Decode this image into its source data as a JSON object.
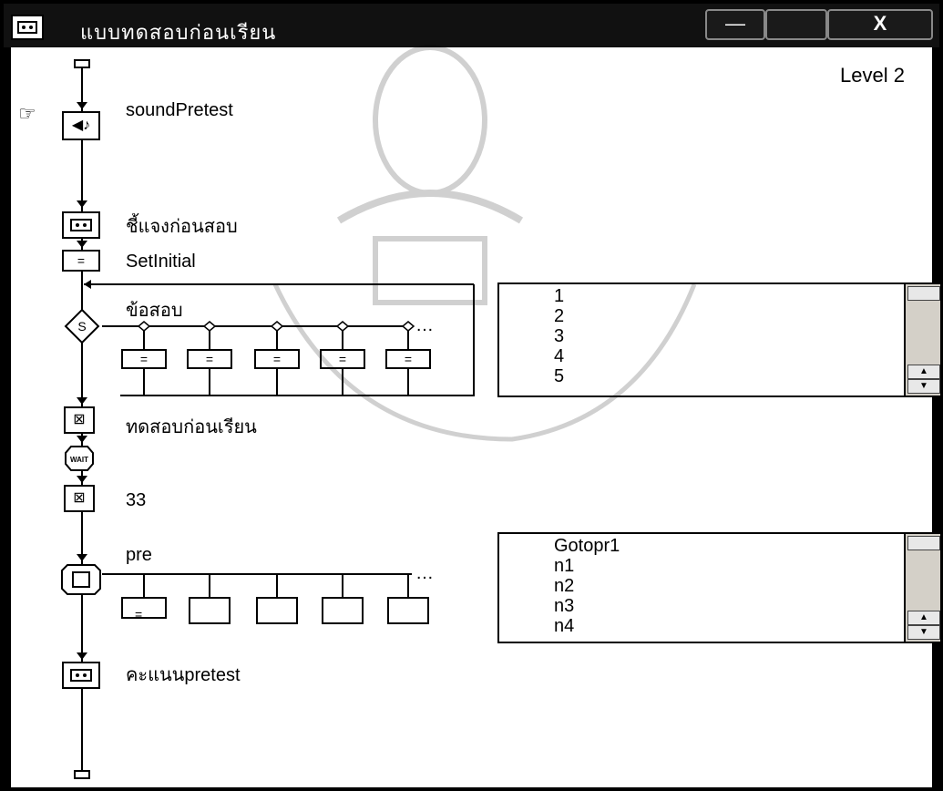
{
  "window": {
    "title": "แบบทดสอบก่อนเรียน",
    "level_label": "Level 2"
  },
  "titlebar": {
    "minimize_glyph": "—",
    "maximize_glyph": "",
    "close_glyph": "X"
  },
  "flow": {
    "nodes": [
      {
        "label": "soundPretest",
        "icon": "sound-icon"
      },
      {
        "label": "ชี้แจงก่อนสอบ",
        "icon": "map-icon"
      },
      {
        "label": "SetInitial",
        "icon": "calculation-icon"
      },
      {
        "label": "ข้อสอบ",
        "icon": "decision-icon",
        "decision_letter": "S"
      },
      {
        "label": "ทดสอบก่อนเรียน",
        "icon": "erase-icon"
      },
      {
        "label": "WAIT",
        "icon": "wait-icon"
      },
      {
        "label": "33",
        "icon": "erase-icon"
      },
      {
        "label": "pre",
        "icon": "framework-icon"
      },
      {
        "label": "คะแนนpretest",
        "icon": "map-icon"
      }
    ],
    "decision_ellipsis": "…",
    "framework_ellipsis": "…"
  },
  "listbox1": {
    "items": [
      "1",
      "2",
      "3",
      "4",
      "5"
    ]
  },
  "listbox2": {
    "items": [
      "Gotopr1",
      "n1",
      "n2",
      "n3",
      "n4"
    ]
  }
}
